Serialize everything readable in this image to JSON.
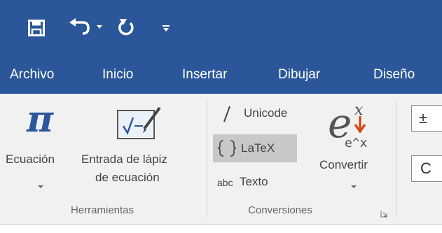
{
  "tabs": [
    "Archivo",
    "Inicio",
    "Insertar",
    "Dibujar",
    "Diseño"
  ],
  "tools": {
    "ecuacion": "Ecuación",
    "lapiz_line1": "Entrada de lápiz",
    "lapiz_line2": "de ecuación",
    "group": "Herramientas"
  },
  "conversions": {
    "unicode": "Unicode",
    "latex": "LaTeX",
    "texto": "Texto",
    "abc": "abc",
    "convertir": "Convertir",
    "group": "Conversiones"
  },
  "gallery": {
    "symbol1": "±",
    "symbol2": "C"
  },
  "colors": {
    "brand": "#2b579a",
    "ribbon": "#f1f1f1",
    "accent_red": "#d83b01",
    "selected": "#c8c8c8"
  },
  "icons": [
    "save-icon",
    "undo-icon",
    "dropdown-caret-icon",
    "redo-icon",
    "customize-qat-icon",
    "pi-icon",
    "ink-equation-icon",
    "unicode-slash-icon",
    "latex-braces-icon",
    "convert-icon",
    "dialog-launcher-icon"
  ]
}
